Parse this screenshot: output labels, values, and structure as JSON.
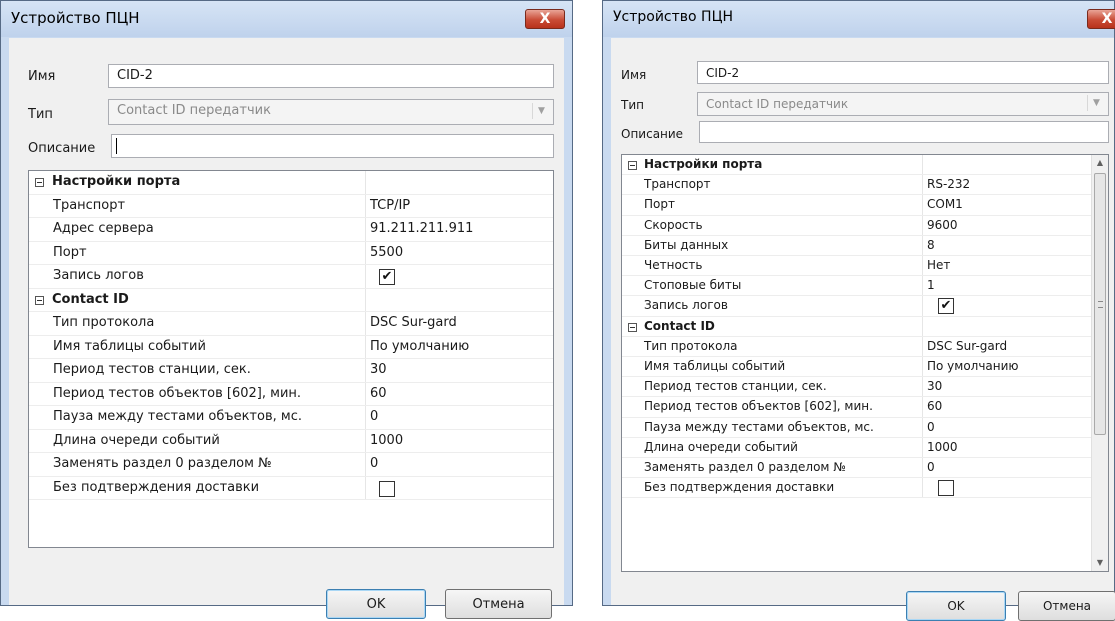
{
  "left": {
    "title": "Устройство ПЦН",
    "close_glyph": "X",
    "name_label": "Имя",
    "name_value": "CID-2",
    "type_label": "Тип",
    "type_value": "Contact ID передатчик",
    "desc_label": "Описание",
    "desc_value": "",
    "cat_port": "Настройки порта",
    "port_rows": [
      {
        "name": "Транспорт",
        "value": "TCP/IP"
      },
      {
        "name": "Адрес сервера",
        "value": "91.211.211.911"
      },
      {
        "name": "Порт",
        "value": "5500"
      },
      {
        "name": "Запись логов",
        "checked": true
      }
    ],
    "cat_cid": "Contact ID",
    "cid_rows": [
      {
        "name": "Тип протокола",
        "value": "DSC Sur-gard"
      },
      {
        "name": "Имя таблицы событий",
        "value": "По умолчанию"
      },
      {
        "name": "Период тестов станции, сек.",
        "value": "30"
      },
      {
        "name": "Период тестов объектов [602], мин.",
        "value": "60"
      },
      {
        "name": "Пауза между тестами объектов, мс.",
        "value": "0"
      },
      {
        "name": "Длина очереди событий",
        "value": "1000"
      },
      {
        "name": "Заменять раздел 0 разделом №",
        "value": "0"
      },
      {
        "name": "Без подтверждения доставки",
        "checked": false
      }
    ],
    "ok_label": "OK",
    "cancel_label": "Отмена"
  },
  "right": {
    "title": "Устройство ПЦН",
    "close_glyph": "X",
    "name_label": "Имя",
    "name_value": "CID-2",
    "type_label": "Тип",
    "type_value": "Contact ID передатчик",
    "desc_label": "Описание",
    "desc_value": "",
    "cat_port": "Настройки порта",
    "port_rows": [
      {
        "name": "Транспорт",
        "value": "RS-232"
      },
      {
        "name": "Порт",
        "value": "COM1"
      },
      {
        "name": "Скорость",
        "value": "9600"
      },
      {
        "name": "Биты данных",
        "value": "8"
      },
      {
        "name": "Четность",
        "value": "Нет"
      },
      {
        "name": "Стоповые биты",
        "value": "1"
      },
      {
        "name": "Запись логов",
        "checked": true
      }
    ],
    "cat_cid": "Contact ID",
    "cid_rows": [
      {
        "name": "Тип протокола",
        "value": "DSC Sur-gard"
      },
      {
        "name": "Имя таблицы событий",
        "value": "По умолчанию"
      },
      {
        "name": "Период тестов станции, сек.",
        "value": "30"
      },
      {
        "name": "Период тестов объектов [602], мин.",
        "value": "60"
      },
      {
        "name": "Пауза между тестами объектов, мс.",
        "value": "0"
      },
      {
        "name": "Длина очереди событий",
        "value": "1000"
      },
      {
        "name": "Заменять раздел 0 разделом №",
        "value": "0"
      },
      {
        "name": "Без подтверждения доставки",
        "checked": false
      }
    ],
    "ok_label": "OK",
    "cancel_label": "Отмена"
  },
  "icons": {
    "collapse": "collapse-icon",
    "check": "checkmark-icon",
    "close": "close-icon",
    "dropdown": "chevron-down-icon"
  }
}
